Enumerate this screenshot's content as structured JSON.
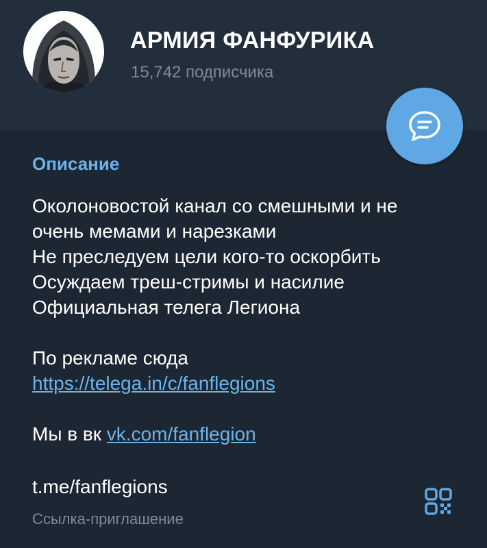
{
  "channel": {
    "name": "АРМИЯ ФАНФУРИКА",
    "subscribers": "15,742 подписчика",
    "avatar_icon": "hooded-figure-avatar"
  },
  "fab": {
    "icon": "chat-bubble-icon"
  },
  "description": {
    "heading": "Описание",
    "lines": [
      "Околоновостой канал со смешными и не",
      "очень мемами и нарезками",
      "Не преследуем цели кого-то оскорбить",
      "Осуждаем треш-стримы и насилие",
      "Официальная телега Легиона"
    ],
    "ads_label": "По рекламе сюда",
    "ads_link": "https://telega.in/c/fanflegions",
    "vk_prefix": "Мы в вк",
    "vk_link": "vk.com/fanflegion"
  },
  "invite": {
    "link": "t.me/fanflegions",
    "caption": "Ссылка-приглашение",
    "qr_icon": "qr-code-icon"
  },
  "colors": {
    "background": "#1d2733",
    "header": "#232e3c",
    "accent": "#6cb3ea",
    "fab": "#5fa8e4",
    "muted": "#7f8b97"
  }
}
